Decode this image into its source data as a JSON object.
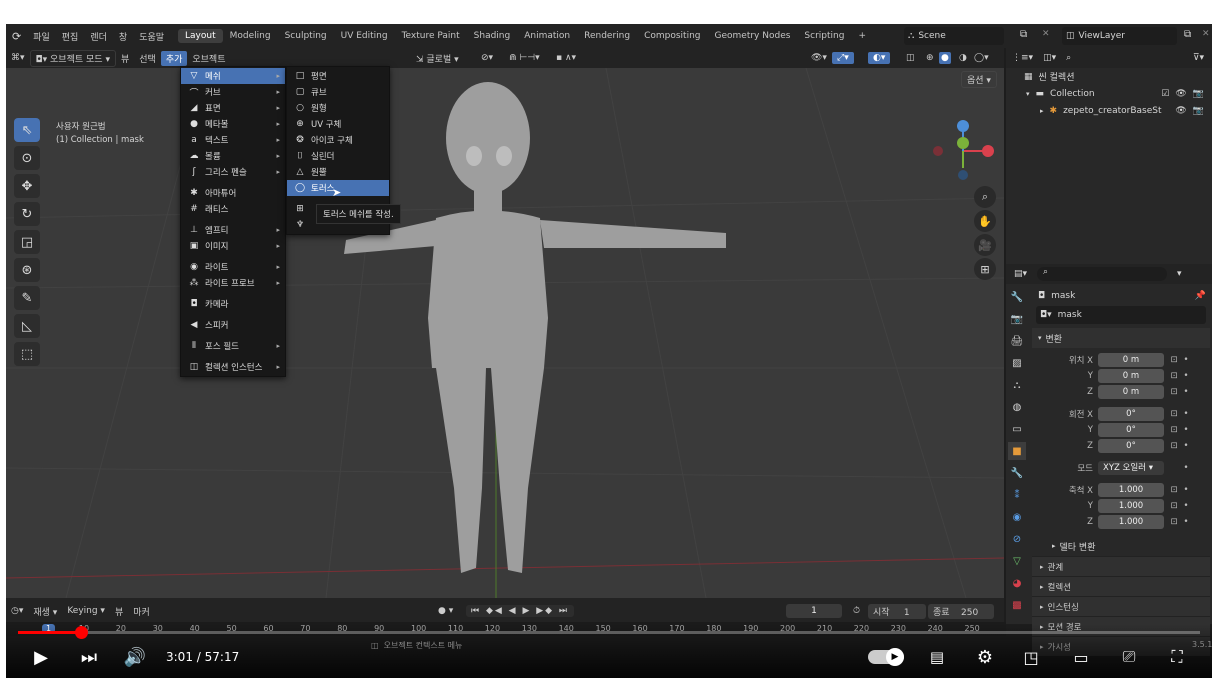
{
  "topbar": {
    "menus": [
      "파일",
      "편집",
      "렌더",
      "창",
      "도움말"
    ],
    "workspaces": [
      "Layout",
      "Modeling",
      "Sculpting",
      "UV Editing",
      "Texture Paint",
      "Shading",
      "Animation",
      "Rendering",
      "Compositing",
      "Geometry Nodes",
      "Scripting"
    ],
    "add_tab": "+",
    "scene": "Scene",
    "view_layer": "ViewLayer"
  },
  "viewport_header": {
    "mode": "오브젝트 모드",
    "view": "뷰",
    "select": "선택",
    "add": "추가",
    "object": "오브젝트",
    "transform": "글로벌",
    "options": "옵션"
  },
  "viewport_info": {
    "view_name": "사용자 원근법",
    "collection": "(1) Collection | mask"
  },
  "add_menu": [
    {
      "label": "메쉬",
      "icon": "▽",
      "sub": true,
      "highlight": true
    },
    {
      "label": "커브",
      "icon": "⌒",
      "sub": true
    },
    {
      "label": "표면",
      "icon": "◢",
      "sub": true
    },
    {
      "label": "메타볼",
      "icon": "●",
      "sub": true
    },
    {
      "label": "텍스트",
      "icon": "a",
      "sub": true
    },
    {
      "label": "볼륨",
      "icon": "☁",
      "sub": true
    },
    {
      "label": "그리스 펜슬",
      "icon": "ʃ",
      "sub": true
    },
    {
      "sep": true
    },
    {
      "label": "아마튜어",
      "icon": "✱",
      "sub": false
    },
    {
      "label": "래티스",
      "icon": "#",
      "sub": false
    },
    {
      "sep": true
    },
    {
      "label": "엠프티",
      "icon": "⊥",
      "sub": true
    },
    {
      "label": "이미지",
      "icon": "▣",
      "sub": true
    },
    {
      "sep": true
    },
    {
      "label": "라이트",
      "icon": "◉",
      "sub": true
    },
    {
      "label": "라이트 프로브",
      "icon": "⁂",
      "sub": true
    },
    {
      "sep": true
    },
    {
      "label": "카메라",
      "icon": "◘",
      "sub": false
    },
    {
      "sep": true
    },
    {
      "label": "스피커",
      "icon": "◀",
      "sub": false
    },
    {
      "sep": true
    },
    {
      "label": "포스 필드",
      "icon": "⦀",
      "sub": true
    },
    {
      "sep": true
    },
    {
      "label": "컬렉션 인스턴스",
      "icon": "◫",
      "sub": true
    }
  ],
  "mesh_menu": [
    {
      "label": "평면",
      "icon": "□"
    },
    {
      "label": "큐브",
      "icon": "▢"
    },
    {
      "label": "원형",
      "icon": "○"
    },
    {
      "label": "UV 구체",
      "icon": "⊕"
    },
    {
      "label": "아이코 구체",
      "icon": "❂"
    },
    {
      "label": "실린더",
      "icon": "⌷"
    },
    {
      "label": "원뿔",
      "icon": "△"
    },
    {
      "label": "토러스",
      "icon": "◯",
      "highlight": true
    },
    {
      "sep": true
    },
    {
      "label": "",
      "icon": "⊞"
    },
    {
      "label": "",
      "icon": "♆"
    }
  ],
  "tooltip": "토러스 메쉬를 작성.",
  "outliner": {
    "header": "씬 컬렉션",
    "collection": "Collection",
    "object": "zepeto_creatorBaseSt"
  },
  "properties": {
    "object_name": "mask",
    "data_name": "mask",
    "transform_header": "변환",
    "location_label": "위치 X",
    "rotation_label": "회전 X",
    "scale_label": "축척 X",
    "y": "Y",
    "z": "Z",
    "loc": [
      "0 m",
      "0 m",
      "0 m"
    ],
    "rot": [
      "0°",
      "0°",
      "0°"
    ],
    "mode_label": "모드",
    "mode_value": "XYZ 오일러",
    "scale": [
      "1.000",
      "1.000",
      "1.000"
    ],
    "delta": "델타 변환",
    "panels": [
      "관계",
      "컬렉션",
      "인스턴싱",
      "모션 경로",
      "가시성"
    ]
  },
  "timeline": {
    "playback": "재생",
    "keying": "Keying",
    "view": "뷰",
    "marker": "마커",
    "current": "1",
    "start_label": "시작",
    "start": "1",
    "end_label": "종료",
    "end": "250",
    "ticks": [
      "1",
      "10",
      "20",
      "30",
      "40",
      "50",
      "60",
      "70",
      "80",
      "90",
      "100",
      "110",
      "120",
      "130",
      "140",
      "150",
      "160",
      "170",
      "180",
      "190",
      "200",
      "210",
      "220",
      "230",
      "240",
      "250"
    ]
  },
  "status": {
    "context_menu": "오브젝트 컨텍스트 메뉴",
    "version": "3.5.1"
  },
  "player": {
    "time_current": "3:01",
    "time_sep": "/",
    "time_total": "57:17",
    "progress": 0.053,
    "accent": "#ff0000"
  }
}
